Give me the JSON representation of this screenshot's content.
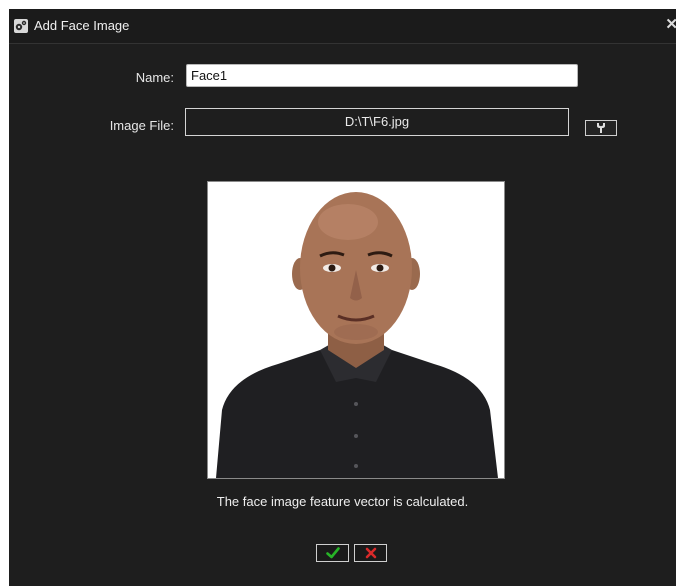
{
  "dialog": {
    "title": "Add Face Image",
    "close_symbol": "✕"
  },
  "form": {
    "name_label": "Name:",
    "name_value": "Face1",
    "file_label": "Image File:",
    "file_value": "D:\\T\\F6.jpg"
  },
  "status": {
    "message": "The face image feature vector is calculated."
  },
  "icons": {
    "title_icon": "gear-icon",
    "browse_icon": "wrench-icon",
    "ok_icon": "checkmark-icon",
    "cancel_icon": "x-icon"
  },
  "colors": {
    "background": "#1e1e1e",
    "ok_green": "#27b327",
    "cancel_red": "#d92a2a"
  }
}
